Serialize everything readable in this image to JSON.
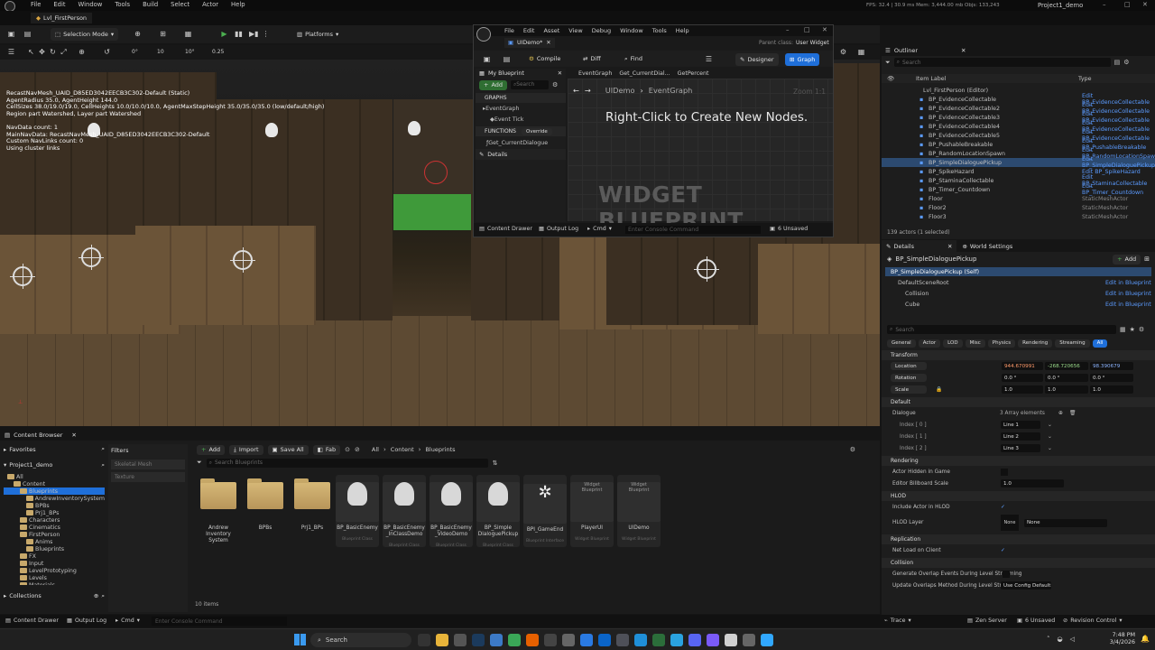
{
  "menu": {
    "items": [
      "File",
      "Edit",
      "Window",
      "Tools",
      "Build",
      "Select",
      "Actor",
      "Help"
    ]
  },
  "level_tab": "Lvl_FirstPerson",
  "perf": "FPS: 32.4  |  30.9 ms  Mem: 3,444.00 mb  Objs: 133,243",
  "project_name": "Project1_demo",
  "toolbar": {
    "selection_mode": "Selection Mode",
    "platforms": "Platforms"
  },
  "viewport": {
    "snap_values": [
      "0°",
      "10",
      "10°",
      "0.25"
    ],
    "stats": "RecastNavMesh_UAID_D85ED3042EECB3C302-Default (Static)\nAgentRadius 35.0, AgentHeight 144.0\nCellSizes 38.0/19.0/19.0, CellHeights 10.0/10.0/10.0, AgentMaxStepHeight 35.0/35.0/35.0 (low/default/high)\nRegion part Watershed, Layer part Watershed\n\nNavData count: 1\nMainNavData: RecastNavMesh_UAID_D85ED3042EECB3C302-Default\nCustom NavLinks count: 0\nUsing cluster links"
  },
  "bp_window": {
    "menu": [
      "File",
      "Edit",
      "Asset",
      "View",
      "Debug",
      "Window",
      "Tools",
      "Help"
    ],
    "tab": "UIDemo*",
    "parent_class_label": "Parent class:",
    "parent_class": "User Widget",
    "compile": "Compile",
    "diff": "Diff",
    "find": "Find",
    "designer": "Designer",
    "graph": "Graph",
    "my_blueprint": "My Blueprint",
    "add": "Add",
    "search_placeholder": "Search",
    "graph_tabs": [
      "EventGraph",
      "Get_CurrentDial...",
      "GetPercent"
    ],
    "breadcrumb_root": "UIDemo",
    "breadcrumb_child": "EventGraph",
    "zoom": "Zoom 1:1",
    "graphs_header": "GRAPHS",
    "event_graph": "EventGraph",
    "event_tick": "Event Tick",
    "functions_header": "FUNCTIONS",
    "override": "Override",
    "func_item": "Get_CurrentDialogue",
    "details": "Details",
    "hint": "Right-Click to Create New Nodes.",
    "watermark": "WIDGET BLUEPRINT",
    "content_drawer": "Content Drawer",
    "output_log": "Output Log",
    "cmd": "Cmd",
    "console_placeholder": "Enter Console Command",
    "unsaved": "6 Unsaved"
  },
  "outliner": {
    "title": "Outliner",
    "search_placeholder": "Search",
    "col_label": "Item Label",
    "col_type": "Type",
    "root": "Lvl_FirstPerson (Editor)",
    "rows": [
      {
        "name": "BP_EvidenceCollectable",
        "type": "Edit BP_EvidenceCollectable"
      },
      {
        "name": "BP_EvidenceCollectable2",
        "type": "Edit BP_EvidenceCollectable"
      },
      {
        "name": "BP_EvidenceCollectable3",
        "type": "Edit BP_EvidenceCollectable"
      },
      {
        "name": "BP_EvidenceCollectable4",
        "type": "Edit BP_EvidenceCollectable"
      },
      {
        "name": "BP_EvidenceCollectable5",
        "type": "Edit BP_EvidenceCollectable"
      },
      {
        "name": "BP_PushableBreakable",
        "type": "Edit BP_PushableBreakable"
      },
      {
        "name": "BP_RandomLocationSpawn",
        "type": "Edit BP_RandomLocationSpawn"
      },
      {
        "name": "BP_SimpleDialoguePickup",
        "type": "Edit BP_SimpleDialoguePickup"
      },
      {
        "name": "BP_SpikeHazard",
        "type": "Edit BP_SpikeHazard"
      },
      {
        "name": "BP_StaminaCollectable",
        "type": "Edit BP_StaminaCollectable"
      },
      {
        "name": "BP_Timer_Countdown",
        "type": "Edit BP_Timer_Countdown"
      },
      {
        "name": "Floor",
        "type": "StaticMeshActor"
      },
      {
        "name": "Floor2",
        "type": "StaticMeshActor"
      },
      {
        "name": "Floor3",
        "type": "StaticMeshActor"
      }
    ],
    "count": "139 actors (1 selected)"
  },
  "details": {
    "tab": "Details",
    "world_settings": "World Settings",
    "actor": "BP_SimpleDialoguePickup",
    "add": "Add",
    "self_row": "BP_SimpleDialoguePickup (Self)",
    "components": [
      {
        "name": "DefaultSceneRoot",
        "action": "Edit in Blueprint"
      },
      {
        "name": "Collision",
        "action": "Edit in Blueprint"
      },
      {
        "name": "Cube",
        "action": "Edit in Blueprint"
      }
    ],
    "search_placeholder": "Search",
    "filters": [
      "General",
      "Actor",
      "LOD",
      "Misc",
      "Physics",
      "Rendering",
      "Streaming",
      "All"
    ],
    "transform": "Transform",
    "location": "Location",
    "location_vals": [
      "944.670991",
      "-268.720656",
      "98.390679"
    ],
    "rotation": "Rotation",
    "rotation_vals": [
      "0.0 °",
      "0.0 °",
      "0.0 °"
    ],
    "scale": "Scale",
    "scale_vals": [
      "1.0",
      "1.0",
      "1.0"
    ],
    "default": "Default",
    "dialogue": "Dialogue",
    "array_elements": "3 Array elements",
    "indices": [
      {
        "label": "Index [ 0 ]",
        "value": "Line 1"
      },
      {
        "label": "Index [ 1 ]",
        "value": "Line 2"
      },
      {
        "label": "Index [ 2 ]",
        "value": "Line 3"
      }
    ],
    "rendering": "Rendering",
    "actor_hidden": "Actor Hidden in Game",
    "billboard_scale": "Editor Billboard Scale",
    "billboard_val": "1.0",
    "hlod": "HLOD",
    "include_hlod": "Include Actor in HLOD",
    "hlod_layer": "HLOD Layer",
    "none": "None",
    "replication": "Replication",
    "net_load": "Net Load on Client",
    "collision": "Collision",
    "gen_overlap": "Generate Overlap Events During Level Streaming",
    "update_overlap": "Update Overlaps Method During Level Stream...",
    "use_config": "Use Config Default"
  },
  "content_browser": {
    "title": "Content Browser",
    "add": "Add",
    "import": "Import",
    "save_all": "Save All",
    "fab": "Fab",
    "path": [
      "All",
      "Content",
      "Blueprints"
    ],
    "search_placeholder": "Search Blueprints",
    "favorites": "Favorites",
    "project": "Project1_demo",
    "filters": "Filters",
    "filter_items": [
      "Skeletal Mesh",
      "Texture"
    ],
    "tree": [
      {
        "label": "All",
        "indent": 0
      },
      {
        "label": "Content",
        "indent": 1
      },
      {
        "label": "Blueprints",
        "indent": 2,
        "selected": true
      },
      {
        "label": "AndrewInventorySystem",
        "indent": 3
      },
      {
        "label": "BPBs",
        "indent": 3
      },
      {
        "label": "Prj1_BPs",
        "indent": 3
      },
      {
        "label": "Characters",
        "indent": 2
      },
      {
        "label": "Cinematics",
        "indent": 2
      },
      {
        "label": "FirstPerson",
        "indent": 2
      },
      {
        "label": "Anims",
        "indent": 3
      },
      {
        "label": "Blueprints",
        "indent": 3
      },
      {
        "label": "FX",
        "indent": 2
      },
      {
        "label": "Input",
        "indent": 2
      },
      {
        "label": "LevelPrototyping",
        "indent": 2
      },
      {
        "label": "Levels",
        "indent": 2
      },
      {
        "label": "Materials",
        "indent": 2
      }
    ],
    "assets": [
      {
        "label": "Andrew Inventory System",
        "kind": "folder",
        "cls": ""
      },
      {
        "label": "BPBs",
        "kind": "folder",
        "cls": ""
      },
      {
        "label": "Prj1_BPs",
        "kind": "folder",
        "cls": ""
      },
      {
        "label": "BP_BasicEnemy",
        "kind": "bp",
        "cls": "Blueprint Class"
      },
      {
        "label": "BP_BasicEnemy _InClassDemo",
        "kind": "bp",
        "cls": "Blueprint Class"
      },
      {
        "label": "BP_BasicEnemy _VideoDemo",
        "kind": "bp",
        "cls": "Blueprint Class"
      },
      {
        "label": "BP_Simple DialoguePickup",
        "kind": "bp",
        "cls": "Blueprint Class"
      },
      {
        "label": "BPI_GameEnd",
        "kind": "bp",
        "cls": "Blueprint Interface"
      },
      {
        "label": "PlayerUI",
        "kind": "bp",
        "cls": "Widget Blueprint"
      },
      {
        "label": "UIDemo",
        "kind": "bp",
        "cls": "Widget Blueprint"
      }
    ],
    "widget_thumb_text": "Widget Blueprint",
    "bp_class_thumb_text": "Blueprint Class",
    "items_count": "10 items",
    "collections": "Collections"
  },
  "status": {
    "content_drawer": "Content Drawer",
    "output_log": "Output Log",
    "cmd": "Cmd",
    "console_placeholder": "Enter Console Command",
    "trace": "Trace",
    "zen": "Zen Server",
    "unsaved": "6 Unsaved",
    "revision": "Revision Control"
  },
  "taskbar": {
    "search": "Search",
    "time": "7:48 PM",
    "date": "3/4/2026"
  }
}
